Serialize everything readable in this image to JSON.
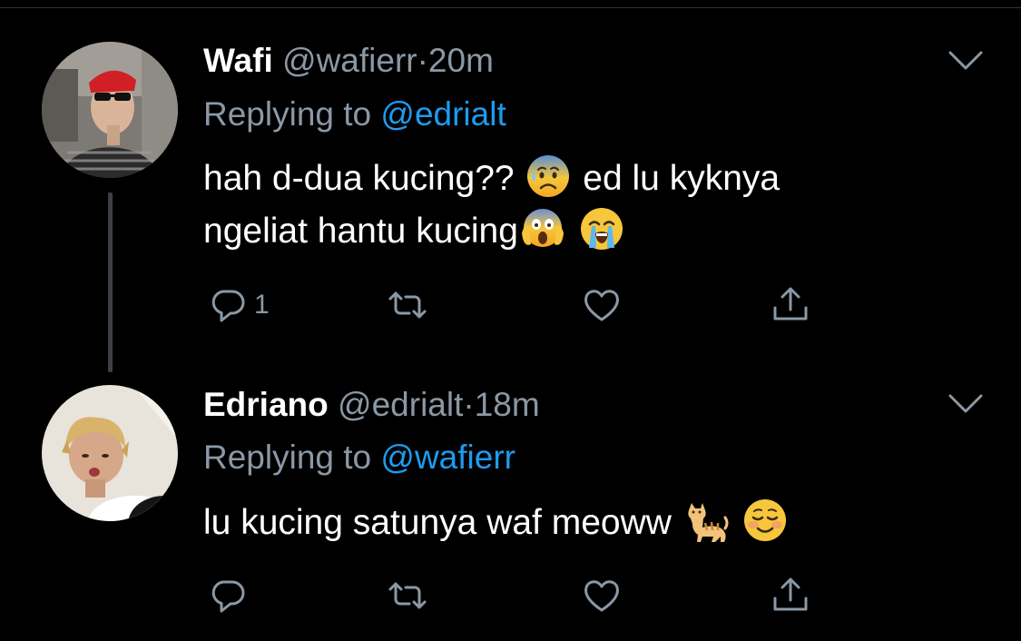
{
  "theme": {
    "background": "#000000",
    "text_primary": "#ffffff",
    "text_secondary": "#8b98a5",
    "accent": "#1d9bf0",
    "thread_line": "#3d4145"
  },
  "tweets": [
    {
      "display_name": "Wafi",
      "handle": "@wafierr",
      "separator": "·",
      "time": "20m",
      "reply_prefix": "Replying to",
      "reply_to": "@edrialt",
      "text_line_1": "hah d-dua kucing??",
      "text_line_1b": "ed lu kyknya",
      "text_line_2": "ngeliat hantu kucing",
      "emojis": [
        "anxious-sweat-emoji",
        "screaming-fear-emoji",
        "loudly-crying-emoji"
      ],
      "reply_count": "1",
      "icons": [
        "reply-icon",
        "retweet-icon",
        "like-icon",
        "share-icon"
      ]
    },
    {
      "display_name": "Edriano",
      "handle": "@edrialt",
      "separator": "·",
      "time": "18m",
      "reply_prefix": "Replying to",
      "reply_to": "@wafierr",
      "text_line_1": "lu kucing satunya waf meoww",
      "emojis": [
        "cat-emoji",
        "smiling-blush-emoji"
      ],
      "reply_count": "",
      "icons": [
        "reply-icon",
        "retweet-icon",
        "like-icon",
        "share-icon"
      ]
    }
  ]
}
